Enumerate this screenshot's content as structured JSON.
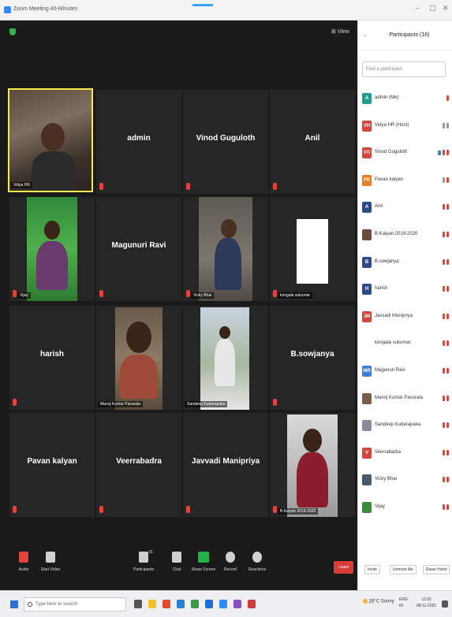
{
  "window": {
    "title": "Zoom Meeting 40-Minutes",
    "minimize": "–",
    "maximize": "□",
    "close": "✕"
  },
  "meeting": {
    "view_label": "View",
    "tiles": [
      {
        "name": "",
        "caption": "Vidya HR"
      },
      {
        "name": "admin",
        "caption": ""
      },
      {
        "name": "Vinod Guguloth",
        "caption": ""
      },
      {
        "name": "Anil",
        "caption": ""
      },
      {
        "name": "",
        "caption": "Vijay"
      },
      {
        "name": "Magunuri Ravi",
        "caption": ""
      },
      {
        "name": "",
        "caption": "Vicky Bhai"
      },
      {
        "name": "",
        "caption": "kongala sukumar"
      },
      {
        "name": "harish",
        "caption": ""
      },
      {
        "name": "",
        "caption": "Manoj Kumar Pavurala"
      },
      {
        "name": "",
        "caption": "Sandeep Kudarapaka"
      },
      {
        "name": "B.sowjanya",
        "caption": ""
      },
      {
        "name": "Pavan kalyan",
        "caption": ""
      },
      {
        "name": "Veerrabadra",
        "caption": ""
      },
      {
        "name": "Javvadi Manipriya",
        "caption": ""
      },
      {
        "name": "",
        "caption": "B.Kalyan 2019-2020"
      }
    ]
  },
  "toolbar": {
    "audio": "Audio",
    "video": "Start Video",
    "participants": "Participants",
    "participants_count": "16",
    "chat": "Chat",
    "share": "Share Screen",
    "record": "Record",
    "reactions": "Reactions",
    "leave": "Leave"
  },
  "panel": {
    "title": "Participants (16)",
    "collapse_icon": "chevron-down-icon",
    "search_placeholder": "Find a participant",
    "participants": [
      {
        "initial": "A",
        "color": "#1f9e89",
        "name": "admin (Me)"
      },
      {
        "initial": "VH",
        "color": "#d6453d",
        "name": "Vidya HR (Host)"
      },
      {
        "initial": "VG",
        "color": "#d6453d",
        "name": "Vinod Guguloth"
      },
      {
        "initial": "PK",
        "color": "#e67e22",
        "name": "Pavan kalyan"
      },
      {
        "initial": "A",
        "color": "#2e4a8c",
        "name": "Anil"
      },
      {
        "initial": "",
        "color": "#6b4b3e",
        "name": "B.Kalyan 2019-2020"
      },
      {
        "initial": "B",
        "color": "#2e4a8c",
        "name": "B.sowjanya"
      },
      {
        "initial": "H",
        "color": "#2e4a8c",
        "name": "harish"
      },
      {
        "initial": "JM",
        "color": "#d6453d",
        "name": "Javvadi Manipriya"
      },
      {
        "initial": "",
        "color": "",
        "name": "kongala sukumar"
      },
      {
        "initial": "MR",
        "color": "#3b7ddd",
        "name": "Magunuri Ravi"
      },
      {
        "initial": "",
        "color": "#7a5c4b",
        "name": "Manoj Kumar Pavurala"
      },
      {
        "initial": "",
        "color": "#8a8a9a",
        "name": "Sandeep Kudarapaka"
      },
      {
        "initial": "V",
        "color": "#d6453d",
        "name": "Veerrabadra"
      },
      {
        "initial": "",
        "color": "#4a5a6a",
        "name": "Vicky Bhai"
      },
      {
        "initial": "",
        "color": "#3c8c3c",
        "name": "Vijay"
      }
    ],
    "invite": "Invite",
    "unmute_me": "Unmute Me",
    "raise_hand": "Raise Hand"
  },
  "taskbar": {
    "search_placeholder": "Type here to search",
    "weather": "28°C Sunny",
    "lang": "ENG",
    "region": "IN",
    "time": "11:02",
    "date": "08-11-2021"
  }
}
